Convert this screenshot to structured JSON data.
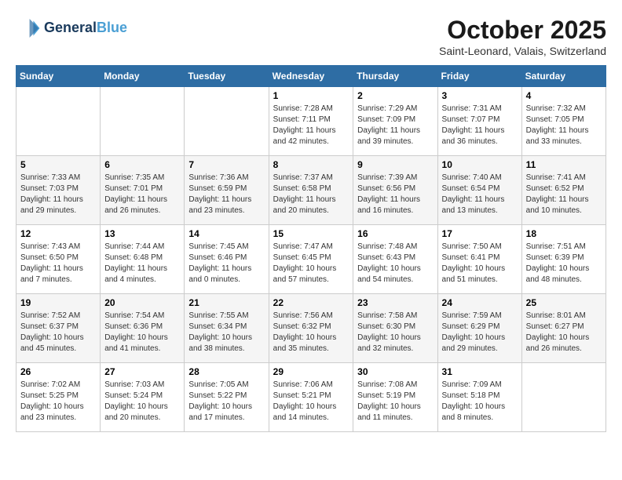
{
  "header": {
    "logo_line1": "General",
    "logo_line2": "Blue",
    "month": "October 2025",
    "location": "Saint-Leonard, Valais, Switzerland"
  },
  "days_of_week": [
    "Sunday",
    "Monday",
    "Tuesday",
    "Wednesday",
    "Thursday",
    "Friday",
    "Saturday"
  ],
  "weeks": [
    [
      {
        "day": "",
        "info": ""
      },
      {
        "day": "",
        "info": ""
      },
      {
        "day": "",
        "info": ""
      },
      {
        "day": "1",
        "info": "Sunrise: 7:28 AM\nSunset: 7:11 PM\nDaylight: 11 hours and 42 minutes."
      },
      {
        "day": "2",
        "info": "Sunrise: 7:29 AM\nSunset: 7:09 PM\nDaylight: 11 hours and 39 minutes."
      },
      {
        "day": "3",
        "info": "Sunrise: 7:31 AM\nSunset: 7:07 PM\nDaylight: 11 hours and 36 minutes."
      },
      {
        "day": "4",
        "info": "Sunrise: 7:32 AM\nSunset: 7:05 PM\nDaylight: 11 hours and 33 minutes."
      }
    ],
    [
      {
        "day": "5",
        "info": "Sunrise: 7:33 AM\nSunset: 7:03 PM\nDaylight: 11 hours and 29 minutes."
      },
      {
        "day": "6",
        "info": "Sunrise: 7:35 AM\nSunset: 7:01 PM\nDaylight: 11 hours and 26 minutes."
      },
      {
        "day": "7",
        "info": "Sunrise: 7:36 AM\nSunset: 6:59 PM\nDaylight: 11 hours and 23 minutes."
      },
      {
        "day": "8",
        "info": "Sunrise: 7:37 AM\nSunset: 6:58 PM\nDaylight: 11 hours and 20 minutes."
      },
      {
        "day": "9",
        "info": "Sunrise: 7:39 AM\nSunset: 6:56 PM\nDaylight: 11 hours and 16 minutes."
      },
      {
        "day": "10",
        "info": "Sunrise: 7:40 AM\nSunset: 6:54 PM\nDaylight: 11 hours and 13 minutes."
      },
      {
        "day": "11",
        "info": "Sunrise: 7:41 AM\nSunset: 6:52 PM\nDaylight: 11 hours and 10 minutes."
      }
    ],
    [
      {
        "day": "12",
        "info": "Sunrise: 7:43 AM\nSunset: 6:50 PM\nDaylight: 11 hours and 7 minutes."
      },
      {
        "day": "13",
        "info": "Sunrise: 7:44 AM\nSunset: 6:48 PM\nDaylight: 11 hours and 4 minutes."
      },
      {
        "day": "14",
        "info": "Sunrise: 7:45 AM\nSunset: 6:46 PM\nDaylight: 11 hours and 0 minutes."
      },
      {
        "day": "15",
        "info": "Sunrise: 7:47 AM\nSunset: 6:45 PM\nDaylight: 10 hours and 57 minutes."
      },
      {
        "day": "16",
        "info": "Sunrise: 7:48 AM\nSunset: 6:43 PM\nDaylight: 10 hours and 54 minutes."
      },
      {
        "day": "17",
        "info": "Sunrise: 7:50 AM\nSunset: 6:41 PM\nDaylight: 10 hours and 51 minutes."
      },
      {
        "day": "18",
        "info": "Sunrise: 7:51 AM\nSunset: 6:39 PM\nDaylight: 10 hours and 48 minutes."
      }
    ],
    [
      {
        "day": "19",
        "info": "Sunrise: 7:52 AM\nSunset: 6:37 PM\nDaylight: 10 hours and 45 minutes."
      },
      {
        "day": "20",
        "info": "Sunrise: 7:54 AM\nSunset: 6:36 PM\nDaylight: 10 hours and 41 minutes."
      },
      {
        "day": "21",
        "info": "Sunrise: 7:55 AM\nSunset: 6:34 PM\nDaylight: 10 hours and 38 minutes."
      },
      {
        "day": "22",
        "info": "Sunrise: 7:56 AM\nSunset: 6:32 PM\nDaylight: 10 hours and 35 minutes."
      },
      {
        "day": "23",
        "info": "Sunrise: 7:58 AM\nSunset: 6:30 PM\nDaylight: 10 hours and 32 minutes."
      },
      {
        "day": "24",
        "info": "Sunrise: 7:59 AM\nSunset: 6:29 PM\nDaylight: 10 hours and 29 minutes."
      },
      {
        "day": "25",
        "info": "Sunrise: 8:01 AM\nSunset: 6:27 PM\nDaylight: 10 hours and 26 minutes."
      }
    ],
    [
      {
        "day": "26",
        "info": "Sunrise: 7:02 AM\nSunset: 5:25 PM\nDaylight: 10 hours and 23 minutes."
      },
      {
        "day": "27",
        "info": "Sunrise: 7:03 AM\nSunset: 5:24 PM\nDaylight: 10 hours and 20 minutes."
      },
      {
        "day": "28",
        "info": "Sunrise: 7:05 AM\nSunset: 5:22 PM\nDaylight: 10 hours and 17 minutes."
      },
      {
        "day": "29",
        "info": "Sunrise: 7:06 AM\nSunset: 5:21 PM\nDaylight: 10 hours and 14 minutes."
      },
      {
        "day": "30",
        "info": "Sunrise: 7:08 AM\nSunset: 5:19 PM\nDaylight: 10 hours and 11 minutes."
      },
      {
        "day": "31",
        "info": "Sunrise: 7:09 AM\nSunset: 5:18 PM\nDaylight: 10 hours and 8 minutes."
      },
      {
        "day": "",
        "info": ""
      }
    ]
  ]
}
